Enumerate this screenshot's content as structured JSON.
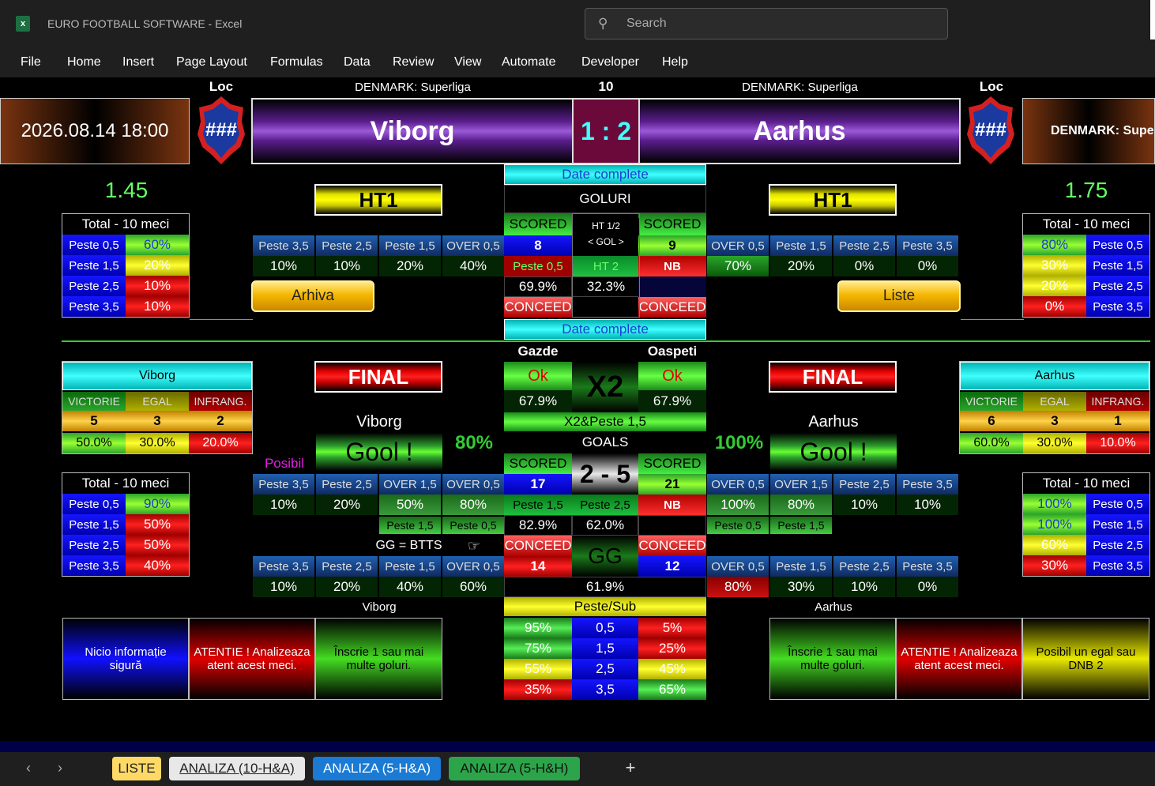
{
  "titlebar": {
    "app": "EURO FOOTBALL SOFTWARE  -  Excel",
    "search_placeholder": "Search"
  },
  "menu": [
    "File",
    "Home",
    "Insert",
    "Page Layout",
    "Formulas",
    "Data",
    "Review",
    "View",
    "Automate",
    "Developer",
    "Help"
  ],
  "header": {
    "loc_label": "Loc",
    "league_left": "DENMARK: Superliga",
    "league_right": "DENMARK: Superliga",
    "round": "10",
    "datetime": "2026.08.14 18:00",
    "right_league_box": "DENMARK: Supe",
    "home": "Viborg",
    "away": "Aarhus",
    "score": "1 : 2",
    "badge": "###"
  },
  "odds": {
    "home": "1.45",
    "away": "1.75"
  },
  "total_box": {
    "title": "Total - 10 meci",
    "labels": [
      "Peste 0,5",
      "Peste 1,5",
      "Peste 2,5",
      "Peste 3,5"
    ],
    "home_top": [
      "60%",
      "20%",
      "10%",
      "10%"
    ],
    "away_top": [
      "80%",
      "30%",
      "20%",
      "0%"
    ],
    "home_bottom": [
      "90%",
      "50%",
      "50%",
      "40%"
    ],
    "away_bottom": [
      "100%",
      "100%",
      "60%",
      "30%"
    ]
  },
  "ht": {
    "label": "HT1",
    "date_complete": "Date complete",
    "goluri": "GOLURI",
    "scored": "SCORED",
    "conceed": "CONCEED",
    "ht_line1": "HT 1/2",
    "ht_line2": "< GOL >",
    "home_scored": "8",
    "away_scored": "9",
    "peste05": "Peste 0,5",
    "ht2": "HT 2",
    "nb": "NB",
    "pct_a": "69.9%",
    "pct_b": "32.3%",
    "home_hdr": [
      "Peste 3,5",
      "Peste 2,5",
      "Peste 1,5",
      "OVER 0,5"
    ],
    "home_vals": [
      "10%",
      "10%",
      "20%",
      "40%"
    ],
    "away_hdr": [
      "OVER 0,5",
      "Peste 1,5",
      "Peste 2,5",
      "Peste 3,5"
    ],
    "away_vals": [
      "70%",
      "20%",
      "0%",
      "0%"
    ],
    "arhiva": "Arhiva",
    "liste": "Liste"
  },
  "final": {
    "label": "FINAL",
    "gazde": "Gazde",
    "oaspeti": "Oaspeti",
    "ok": "Ok",
    "x2": "X2",
    "pct_ok": "67.9%",
    "x2_line": "X2&Peste 1,5",
    "goals": "GOALS",
    "score": "2 - 5",
    "home_scored": "17",
    "away_scored": "21",
    "home_conceded": "14",
    "away_conceded": "12",
    "peste15": "Peste 1,5",
    "peste25": "Peste 2,5",
    "nb": "NB",
    "pct_a": "82.9%",
    "pct_b": "62.0%",
    "gg": "GG",
    "gg_pct": "61.9%",
    "gg_btts": "GG = BTTS",
    "posibil": "Posibil",
    "gool": "Gool !",
    "home_pct": "80%",
    "away_pct": "100%",
    "home_name": "Viborg",
    "away_name": "Aarhus"
  },
  "team_box": {
    "home": "Viborg",
    "away": "Aarhus",
    "cols": [
      "VICTORIE",
      "EGAL",
      "INFRANG."
    ],
    "home_counts": [
      "5",
      "3",
      "2"
    ],
    "home_pcts": [
      "50.0%",
      "30.0%",
      "20.0%"
    ],
    "away_counts": [
      "6",
      "3",
      "1"
    ],
    "away_pcts": [
      "60.0%",
      "30.0%",
      "10.0%"
    ]
  },
  "scored_rows": {
    "home_hdr": [
      "Peste 3,5",
      "Peste 2,5",
      "OVER 1,5",
      "OVER 0,5"
    ],
    "home_vals": [
      "10%",
      "20%",
      "50%",
      "80%"
    ],
    "away_hdr": [
      "OVER 0,5",
      "OVER 1,5",
      "Peste 2,5",
      "Peste 3,5"
    ],
    "away_vals": [
      "100%",
      "80%",
      "10%",
      "10%"
    ],
    "home_small": [
      "Peste 1,5",
      "Peste 0,5"
    ],
    "away_small": [
      "Peste 0,5",
      "Peste 1,5"
    ]
  },
  "conceded_rows": {
    "home_hdr": [
      "Peste 3,5",
      "Peste 2,5",
      "Peste 1,5",
      "OVER 0,5"
    ],
    "home_vals": [
      "10%",
      "20%",
      "40%",
      "60%"
    ],
    "away_hdr": [
      "OVER 0,5",
      "Peste 1,5",
      "Peste 2,5",
      "Peste 3,5"
    ],
    "away_vals": [
      "80%",
      "30%",
      "10%",
      "0%"
    ]
  },
  "peste_sub": {
    "title": "Peste/Sub",
    "over": [
      "95%",
      "75%",
      "55%",
      "35%"
    ],
    "line": [
      "0,5",
      "1,5",
      "2,5",
      "3,5"
    ],
    "under": [
      "5%",
      "25%",
      "45%",
      "65%"
    ]
  },
  "advice": {
    "home_label": "Viborg",
    "away_label": "Aarhus",
    "home": [
      "Nicio informație sigură",
      "ATENTIE ! Analizeaza atent acest meci.",
      "Înscrie 1 sau mai multe goluri."
    ],
    "away": [
      "Înscrie 1 sau mai multe goluri.",
      "ATENTIE ! Analizeaza atent acest meci.",
      "Posibil un egal sau DNB 2"
    ]
  },
  "tabs": [
    "LISTE",
    "ANALIZA (10-H&A)",
    "ANALIZA (5-H&A)",
    "ANALIZA (5-H&H)"
  ]
}
